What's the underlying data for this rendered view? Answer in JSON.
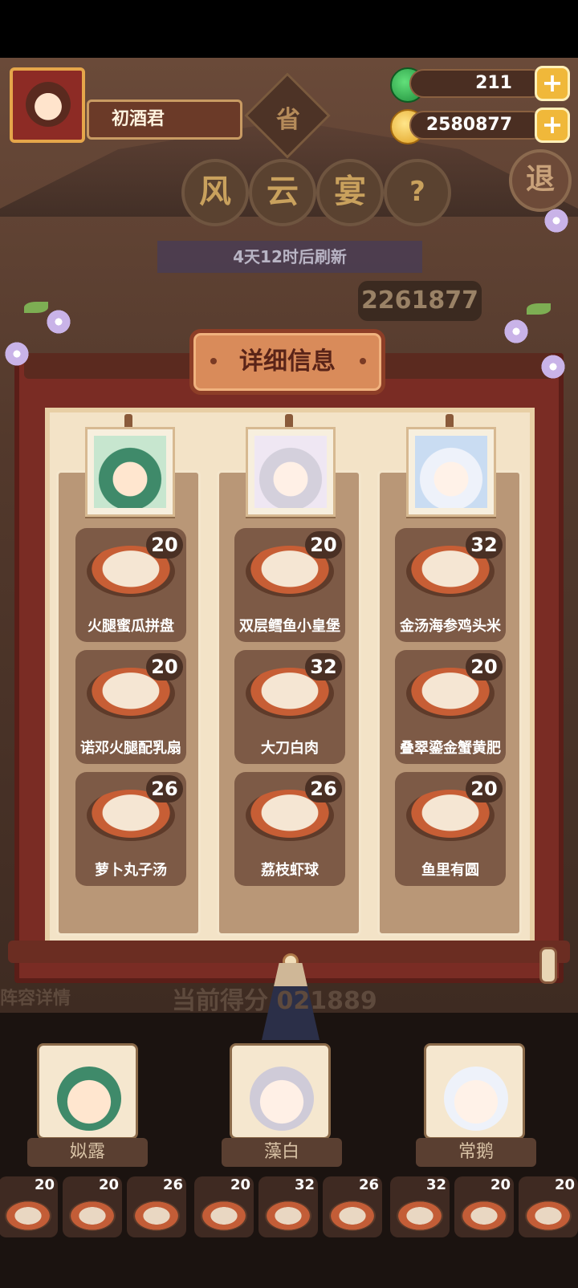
{
  "player": {
    "name": "初酒君"
  },
  "province_badge": "省",
  "currency": {
    "gems": "211",
    "coins": "2580877",
    "plus": "+"
  },
  "exit_label": "退",
  "event_title": [
    "风",
    "云",
    "宴",
    "?"
  ],
  "refresh_text": "4天12时后刷新",
  "top_score": "2261877",
  "panel": {
    "title": "详细信息",
    "columns": [
      {
        "dishes": [
          {
            "name": "火腿蜜瓜拼盘",
            "score": "20"
          },
          {
            "name": "诺邓火腿配乳扇",
            "score": "20"
          },
          {
            "name": "萝卜丸子汤",
            "score": "26"
          }
        ]
      },
      {
        "dishes": [
          {
            "name": "双层鳕鱼小皇堡",
            "score": "20"
          },
          {
            "name": "大刀白肉",
            "score": "32"
          },
          {
            "name": "荔枝虾球",
            "score": "26"
          }
        ]
      },
      {
        "dishes": [
          {
            "name": "金汤海参鸡头米",
            "score": "32"
          },
          {
            "name": "叠翠鎏金蟹黄肥",
            "score": "20"
          },
          {
            "name": "鱼里有圆",
            "score": "20"
          }
        ]
      }
    ]
  },
  "background_text": {
    "current_score": "当前得分 021889",
    "lineup": "阵容详情"
  },
  "heroes": [
    {
      "name": "姒露"
    },
    {
      "name": "藻白"
    },
    {
      "name": "常鹅"
    }
  ],
  "mini_dishes": [
    "20",
    "20",
    "26",
    "20",
    "32",
    "26",
    "32",
    "20",
    "20"
  ],
  "colors": {
    "frame": "#7a2c24",
    "panel_bg": "#f3e3c7",
    "card": "#7d5a46",
    "gold": "#f0b83a"
  }
}
